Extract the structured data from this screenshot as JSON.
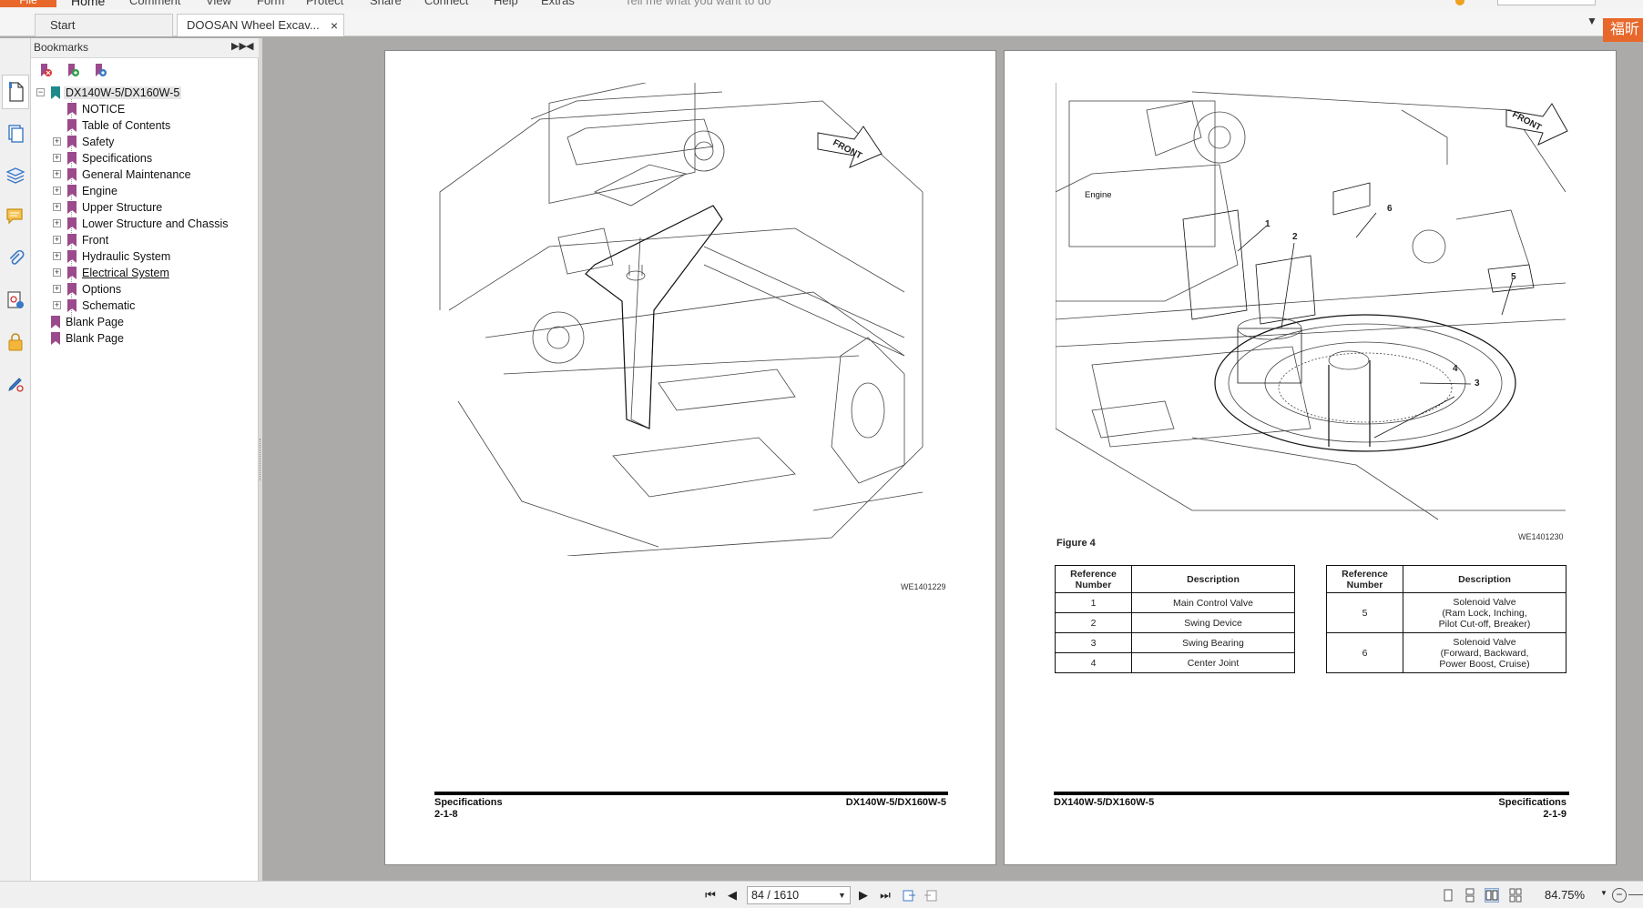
{
  "ribbon": {
    "file": "File",
    "items": [
      "Home",
      "Comment",
      "View",
      "Form",
      "Protect",
      "Share",
      "Connect",
      "Help",
      "Extras"
    ],
    "tell_me": "Tell me what you want to do"
  },
  "tabs": {
    "start": "Start",
    "document": "DOOSAN Wheel Excav...",
    "close": "×",
    "menu_glyph": "▼"
  },
  "brand_badge": "福昕",
  "bookmarks": {
    "title": "Bookmarks",
    "root": "DX140W-5/DX160W-5",
    "items": [
      "NOTICE",
      "Table of Contents",
      "Safety",
      "Specifications",
      "General Maintenance",
      "Engine",
      "Upper Structure",
      "Lower Structure and Chassis",
      "Front",
      "Hydraulic System",
      "Electrical System",
      "Options",
      "Schematic"
    ],
    "blank1": "Blank Page",
    "blank2": "Blank Page"
  },
  "left_page": {
    "front_label": "FRONT",
    "figure_code": "WE1401229",
    "footer_left_title": "Specifications",
    "footer_left_page": "2-1-8",
    "footer_right": "DX140W-5/DX160W-5"
  },
  "right_page": {
    "front_label": "FRONT",
    "engine_label": "Engine",
    "callouts": [
      "1",
      "2",
      "3",
      "4",
      "5",
      "6"
    ],
    "figure_code": "WE1401230",
    "figure_caption": "Figure 4",
    "table_headers": [
      "Reference Number",
      "Description"
    ],
    "table_a": [
      {
        "ref": "1",
        "desc": "Main Control Valve"
      },
      {
        "ref": "2",
        "desc": "Swing Device"
      },
      {
        "ref": "3",
        "desc": "Swing Bearing"
      },
      {
        "ref": "4",
        "desc": "Center Joint"
      }
    ],
    "table_b": [
      {
        "ref": "5",
        "desc_lines": [
          "Solenoid Valve",
          "(Ram Lock, Inching,",
          "Pilot Cut-off, Breaker)"
        ]
      },
      {
        "ref": "6",
        "desc_lines": [
          "Solenoid Valve",
          "(Forward, Backward,",
          "Power Boost, Cruise)"
        ]
      }
    ],
    "footer_left": "DX140W-5/DX160W-5",
    "footer_right_title": "Specifications",
    "footer_right_page": "2-1-9"
  },
  "status": {
    "page_field": "84 / 1610",
    "zoom": "84.75%"
  },
  "colors": {
    "accent_orange": "#e8672a",
    "bookmark_flag": "#9b4a8c",
    "workspace": "#abaaa8"
  }
}
